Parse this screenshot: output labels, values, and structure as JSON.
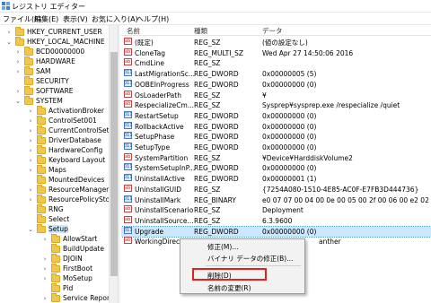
{
  "window": {
    "title": "レジストリ エディター"
  },
  "menu": [
    "ファイル(F)",
    "編集(E)",
    "表示(V)",
    "お気に入り(A)",
    "ヘルプ(H)"
  ],
  "tree": [
    {
      "label": "HKEY_CURRENT_USER",
      "depth": 1,
      "expander": ">"
    },
    {
      "label": "HKEY_LOCAL_MACHINE",
      "depth": 1,
      "expander": "v"
    },
    {
      "label": "BCD00000000",
      "depth": 2,
      "expander": ">"
    },
    {
      "label": "HARDWARE",
      "depth": 2,
      "expander": ">"
    },
    {
      "label": "SAM",
      "depth": 2,
      "expander": ">"
    },
    {
      "label": "SECURITY",
      "depth": 2,
      "expander": ""
    },
    {
      "label": "SOFTWARE",
      "depth": 2,
      "expander": ">"
    },
    {
      "label": "SYSTEM",
      "depth": 2,
      "expander": "v"
    },
    {
      "label": "ActivationBroker",
      "depth": 3,
      "expander": ">"
    },
    {
      "label": "ControlSet001",
      "depth": 3,
      "expander": ">"
    },
    {
      "label": "CurrentControlSet",
      "depth": 3,
      "expander": ">"
    },
    {
      "label": "DriverDatabase",
      "depth": 3,
      "expander": ">"
    },
    {
      "label": "HardwareConfig",
      "depth": 3,
      "expander": ">"
    },
    {
      "label": "Keyboard Layout",
      "depth": 3,
      "expander": ">"
    },
    {
      "label": "Maps",
      "depth": 3,
      "expander": ">"
    },
    {
      "label": "MountedDevices",
      "depth": 3,
      "expander": ""
    },
    {
      "label": "ResourceManager",
      "depth": 3,
      "expander": ">"
    },
    {
      "label": "ResourcePolicySto",
      "depth": 3,
      "expander": ">"
    },
    {
      "label": "RNG",
      "depth": 3,
      "expander": ""
    },
    {
      "label": "Select",
      "depth": 3,
      "expander": ""
    },
    {
      "label": "Setup",
      "depth": 3,
      "expander": "v",
      "selected": true
    },
    {
      "label": "AllowStart",
      "depth": 4,
      "expander": ">"
    },
    {
      "label": "BuildUpdate",
      "depth": 4,
      "expander": ""
    },
    {
      "label": "DJOIN",
      "depth": 4,
      "expander": ">"
    },
    {
      "label": "FirstBoot",
      "depth": 4,
      "expander": ">"
    },
    {
      "label": "MoSetup",
      "depth": 4,
      "expander": ">"
    },
    {
      "label": "Pid",
      "depth": 4,
      "expander": ""
    },
    {
      "label": "Service Report",
      "depth": 4,
      "expander": ">"
    }
  ],
  "list": {
    "headers": [
      "名前",
      "種類",
      "データ"
    ],
    "rows": [
      {
        "name": "(既定)",
        "type": "REG_SZ",
        "data": "(値の設定なし)",
        "icon": "string"
      },
      {
        "name": "CloneTag",
        "type": "REG_MULTI_SZ",
        "data": "Wed Apr 27 14:50:06 2016",
        "icon": "string"
      },
      {
        "name": "CmdLine",
        "type": "REG_SZ",
        "data": "",
        "icon": "string"
      },
      {
        "name": "LastMigrationSc...",
        "type": "REG_DWORD",
        "data": "0x00000005 (5)",
        "icon": "binary"
      },
      {
        "name": "OOBEInProgress",
        "type": "REG_DWORD",
        "data": "0x00000000 (0)",
        "icon": "binary"
      },
      {
        "name": "OsLoaderPath",
        "type": "REG_SZ",
        "data": "¥",
        "icon": "string"
      },
      {
        "name": "RespecializeCm...",
        "type": "REG_SZ",
        "data": "Sysprep¥sysprep.exe /respecialize /quiet",
        "icon": "string"
      },
      {
        "name": "RestartSetup",
        "type": "REG_DWORD",
        "data": "0x00000000 (0)",
        "icon": "binary"
      },
      {
        "name": "RollbackActive",
        "type": "REG_DWORD",
        "data": "0x00000000 (0)",
        "icon": "binary"
      },
      {
        "name": "SetupPhase",
        "type": "REG_DWORD",
        "data": "0x00000000 (0)",
        "icon": "binary"
      },
      {
        "name": "SetupType",
        "type": "REG_DWORD",
        "data": "0x00000000 (0)",
        "icon": "binary"
      },
      {
        "name": "SystemPartition",
        "type": "REG_SZ",
        "data": "¥Device¥HarddiskVolume2",
        "icon": "string"
      },
      {
        "name": "SystemSetupInP...",
        "type": "REG_DWORD",
        "data": "0x00000000 (0)",
        "icon": "binary"
      },
      {
        "name": "UninstallActive",
        "type": "REG_DWORD",
        "data": "0x00000001 (1)",
        "icon": "binary"
      },
      {
        "name": "UninstallGUID",
        "type": "REG_SZ",
        "data": "{7254A080-1510-4E85-AC0F-E7FB3D444736}",
        "icon": "string"
      },
      {
        "name": "UninstallMark",
        "type": "REG_BINARY",
        "data": "e0 07 07 00 04 00 0e 00 05 00 2f 00 06 00 e2 02",
        "icon": "binary"
      },
      {
        "name": "UninstallScenario",
        "type": "REG_SZ",
        "data": "Deployment",
        "icon": "string"
      },
      {
        "name": "UninstallSource...",
        "type": "REG_SZ",
        "data": "6.3.9600",
        "icon": "string"
      },
      {
        "name": "Upgrade",
        "type": "REG_DWORD",
        "data": "0x00000000 (0)",
        "icon": "binary",
        "selected": true
      },
      {
        "name": "WorkingDirectory",
        "type": "",
        "data": "anther",
        "icon": "string"
      }
    ]
  },
  "context_menu": {
    "modify": "修正(M)...",
    "modify_binary": "バイナリ データの修正(B)...",
    "delete": "削除(D)",
    "rename": "名前の変更(R)"
  },
  "colors": {
    "selection": "#cce8ff",
    "highlight_box": "#e0231b",
    "folder": "#f0c74a"
  }
}
